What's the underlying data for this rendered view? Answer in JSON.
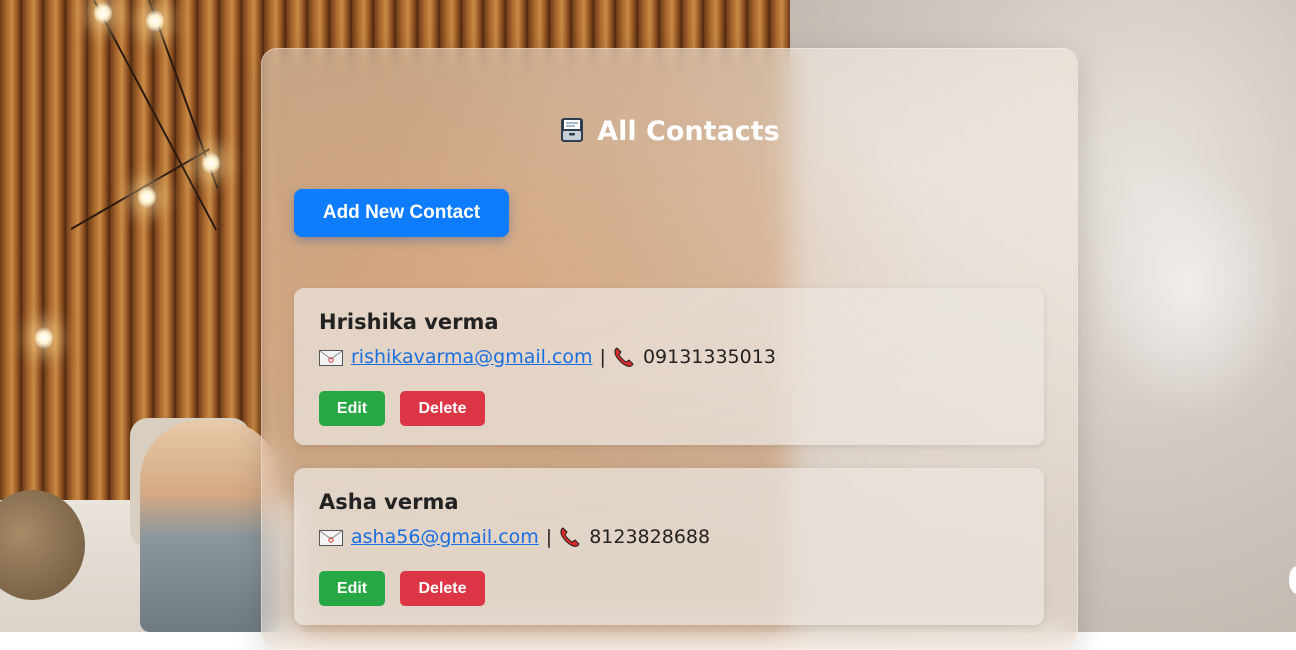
{
  "header": {
    "title": "All Contacts",
    "title_icon": "card-file-box-icon"
  },
  "toolbar": {
    "add_label": "Add New Contact"
  },
  "contacts": [
    {
      "name": "Hrishika verma",
      "email": "rishikavarma@gmail.com",
      "separator": "|",
      "phone": "09131335013",
      "edit_label": "Edit",
      "delete_label": "Delete"
    },
    {
      "name": "Asha verma",
      "email": "asha56@gmail.com",
      "separator": "|",
      "phone": "8123828688",
      "edit_label": "Edit",
      "delete_label": "Delete"
    }
  ],
  "colors": {
    "primary": "#0d7cff",
    "edit": "#28a745",
    "delete": "#dc3545",
    "link": "#1a6fe0"
  }
}
